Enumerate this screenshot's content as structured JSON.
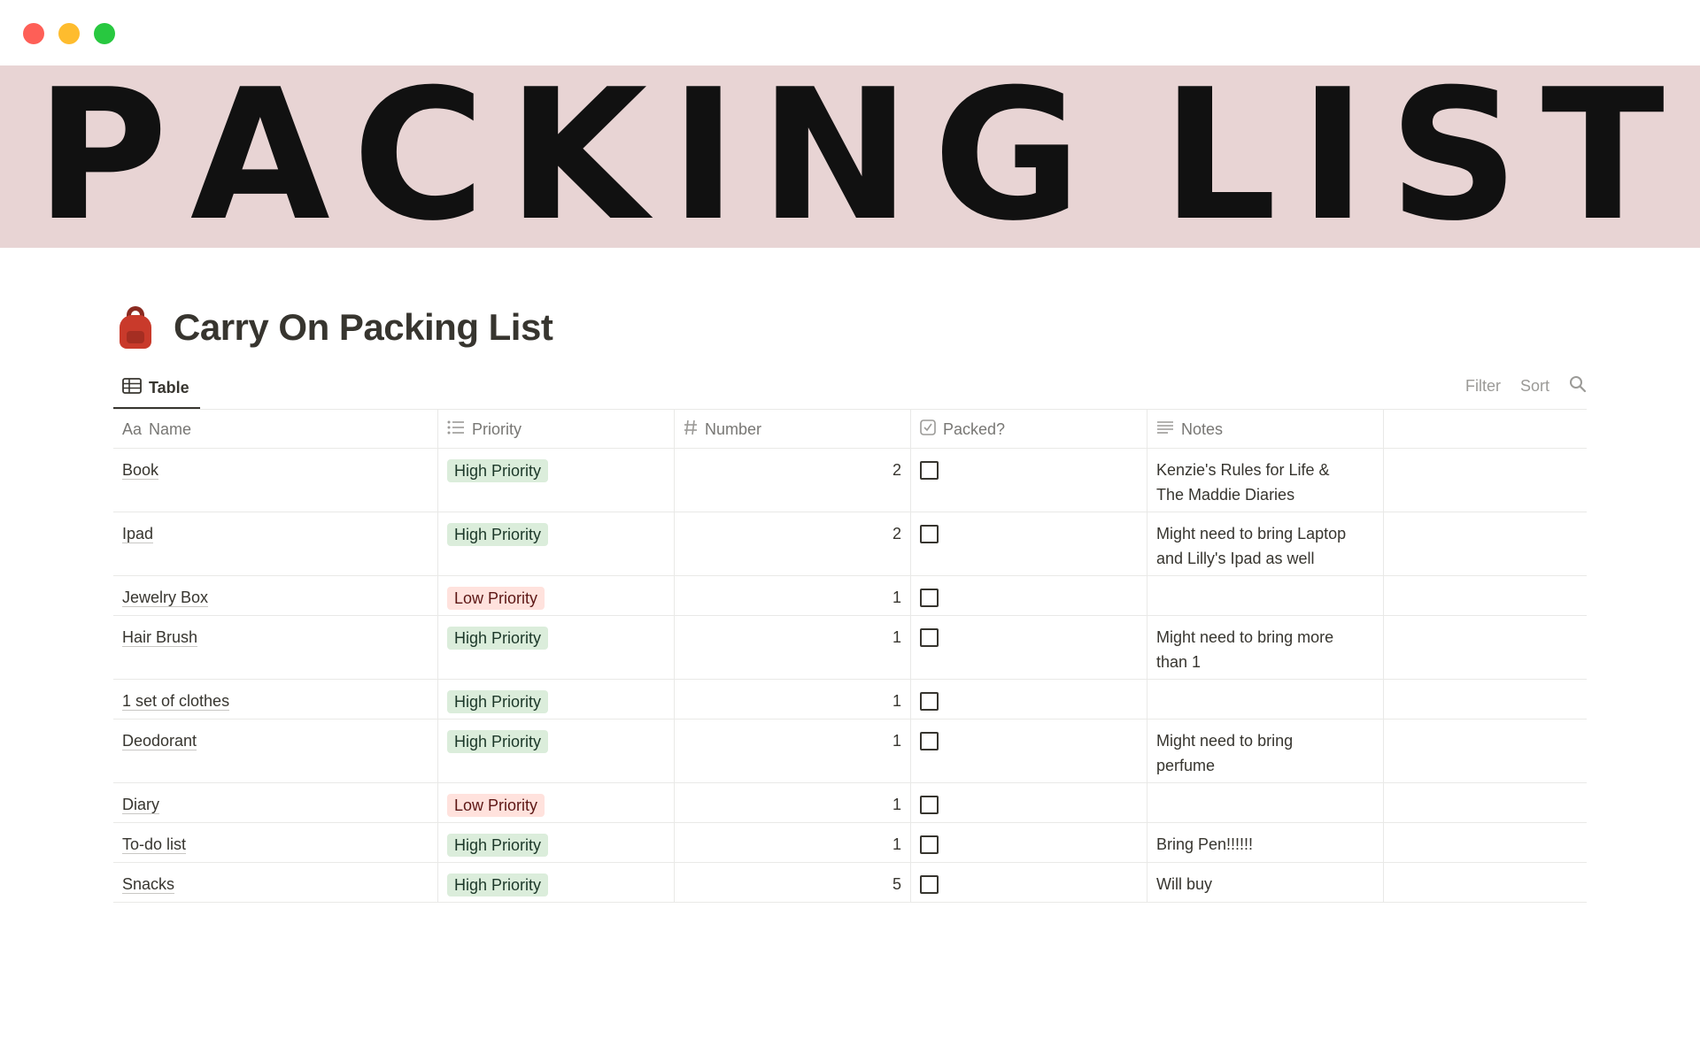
{
  "window": {
    "controls": [
      "close",
      "minimize",
      "maximize"
    ]
  },
  "banner": {
    "text": "PACKING LIST"
  },
  "page": {
    "icon": "backpack-icon",
    "title": "Carry On Packing List"
  },
  "view": {
    "tab_label": "Table",
    "actions": {
      "filter": "Filter",
      "sort": "Sort"
    }
  },
  "table": {
    "columns": [
      {
        "prefix": "Aa",
        "label": "Name"
      },
      {
        "icon": "list-icon",
        "label": "Priority"
      },
      {
        "icon": "hash-icon",
        "label": "Number"
      },
      {
        "icon": "checkbox-icon",
        "label": "Packed?"
      },
      {
        "icon": "text-lines-icon",
        "label": "Notes"
      }
    ],
    "rows": [
      {
        "name": "Book",
        "priority": "High Priority",
        "number": "2",
        "packed": false,
        "notes_lines": [
          "Kenzie's Rules for Life &",
          "The Maddie Diaries"
        ]
      },
      {
        "name": "Ipad",
        "priority": "High Priority",
        "number": "2",
        "packed": false,
        "notes_lines": [
          "Might need to bring Laptop",
          "and Lilly's Ipad as well"
        ]
      },
      {
        "name": "Jewelry Box",
        "priority": "Low Priority",
        "number": "1",
        "packed": false,
        "notes_lines": []
      },
      {
        "name": "Hair Brush",
        "priority": "High Priority",
        "number": "1",
        "packed": false,
        "notes_lines": [
          "Might need to bring more",
          "than 1"
        ]
      },
      {
        "name": "1 set of clothes",
        "priority": "High Priority",
        "number": "1",
        "packed": false,
        "notes_lines": []
      },
      {
        "name": "Deodorant",
        "priority": "High Priority",
        "number": "1",
        "packed": false,
        "notes_lines": [
          "Might need to bring",
          "perfume"
        ]
      },
      {
        "name": "Diary",
        "priority": "Low Priority",
        "number": "1",
        "packed": false,
        "notes_lines": []
      },
      {
        "name": "To-do list",
        "priority": "High Priority",
        "number": "1",
        "packed": false,
        "notes_lines": [
          "Bring Pen!!!!!!"
        ]
      },
      {
        "name": "Snacks",
        "priority": "High Priority",
        "number": "5",
        "packed": false,
        "notes_lines": [
          "Will buy"
        ]
      }
    ]
  },
  "colors": {
    "banner_bg": "#e8d4d4",
    "high_priority_bg": "#dbeddb",
    "low_priority_bg": "#ffe2dd"
  }
}
